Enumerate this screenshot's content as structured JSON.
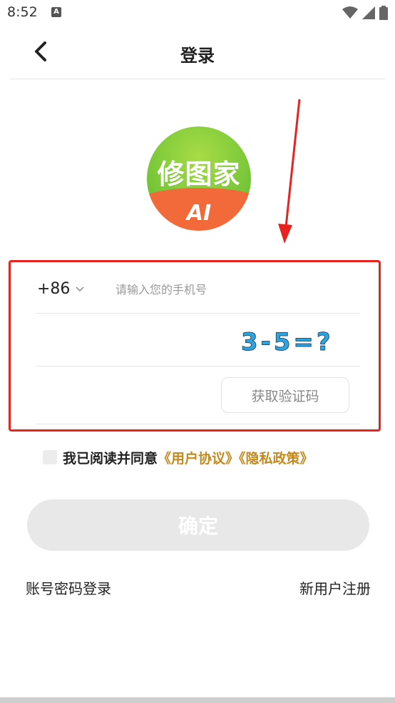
{
  "status_bar": {
    "time": "8:52",
    "notification": "A"
  },
  "header": {
    "title": "登录"
  },
  "logo": {
    "text": "修图家",
    "sub": "AI"
  },
  "form": {
    "country_code": "+86",
    "phone_placeholder": "请输入您的手机号",
    "captcha_text": "3-5=?",
    "get_code_label": "获取验证码"
  },
  "agreement": {
    "text": "我已阅读并同意",
    "user_agreement": "《用户协议》",
    "privacy_policy": "《隐私政策》"
  },
  "confirm_label": "确定",
  "links": {
    "password_login": "账号密码登录",
    "register": "新用户注册"
  },
  "colors": {
    "accent_link": "#c28a1e",
    "annotation_red": "#e8231f",
    "logo_green": "#7cc93a",
    "logo_orange": "#f26a3a"
  }
}
